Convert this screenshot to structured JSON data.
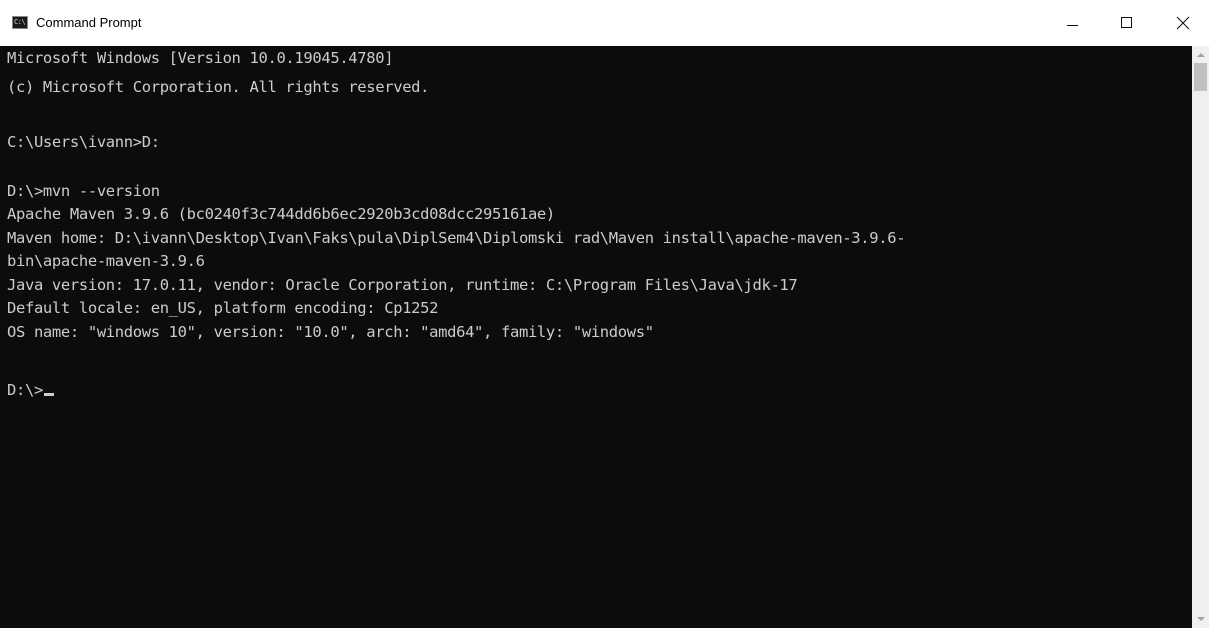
{
  "window": {
    "title": "Command Prompt",
    "icon": "command-prompt-icon",
    "icon_glyph": "C:\\",
    "controls": {
      "minimize": "minimize-icon",
      "maximize": "maximize-icon",
      "close": "close-icon"
    }
  },
  "console": {
    "lines": [
      "Microsoft Windows [Version 10.0.19045.4780]",
      "(c) Microsoft Corporation. All rights reserved.",
      "",
      "C:\\Users\\ivann>D:",
      "",
      "D:\\>mvn --version",
      "Apache Maven 3.9.6 (bc0240f3c744dd6b6ec2920b3cd08dcc295161ae)",
      "Maven home: D:\\ivann\\Desktop\\Ivan\\Faks\\pula\\DiplSem4\\Diplomski rad\\Maven install\\apache-maven-3.9.6-",
      "bin\\apache-maven-3.9.6",
      "Java version: 17.0.11, vendor: Oracle Corporation, runtime: C:\\Program Files\\Java\\jdk-17",
      "Default locale: en_US, platform encoding: Cp1252",
      "OS name: \"windows 10\", version: \"10.0\", arch: \"amd64\", family: \"windows\"",
      "",
      "D:\\>"
    ]
  },
  "colors": {
    "background": "#0c0c0c",
    "text": "#cccccc",
    "titlebar": "#ffffff"
  }
}
